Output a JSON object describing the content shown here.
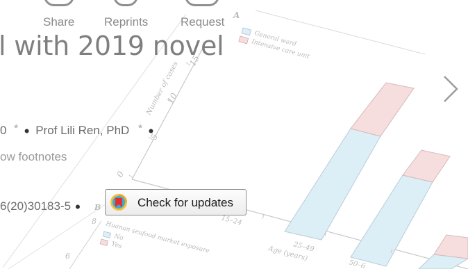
{
  "toolbar": {
    "share_label": "Share",
    "reprints_label": "Reprints",
    "request_label": "Request"
  },
  "article": {
    "title_fragment": "l with 2019 novel",
    "authors_fragment_lead": "0",
    "author_star": "*",
    "author_name": "Prof Lili Ren, PhD",
    "show_footnotes": "ow footnotes",
    "doi_fragment": "6(20)30183-5",
    "check_updates_label": "Check for updates"
  },
  "figure": {
    "panel_a_label": "A",
    "panel_b_label": "B",
    "legend_a": [
      "General ward",
      "Intensive care unit"
    ],
    "ylabel": "Number of cases",
    "yticks": [
      "15",
      "10",
      "5",
      "0"
    ],
    "xtick_fragments": [
      "15–24",
      "25–49",
      "50–6"
    ],
    "xlabel": "Age (years)",
    "panel_b_title": "Huanan seafood market exposure",
    "legend_b": [
      "No",
      "Yes"
    ],
    "panel_b_yticks": [
      "8",
      "6"
    ],
    "colors": {
      "general_ward": "#dceef6",
      "icu": "#f6dede",
      "axis": "#c4c4c4"
    }
  },
  "icons": {
    "next": "chevron-right-icon",
    "updates_logo": "crossmark-icon"
  }
}
